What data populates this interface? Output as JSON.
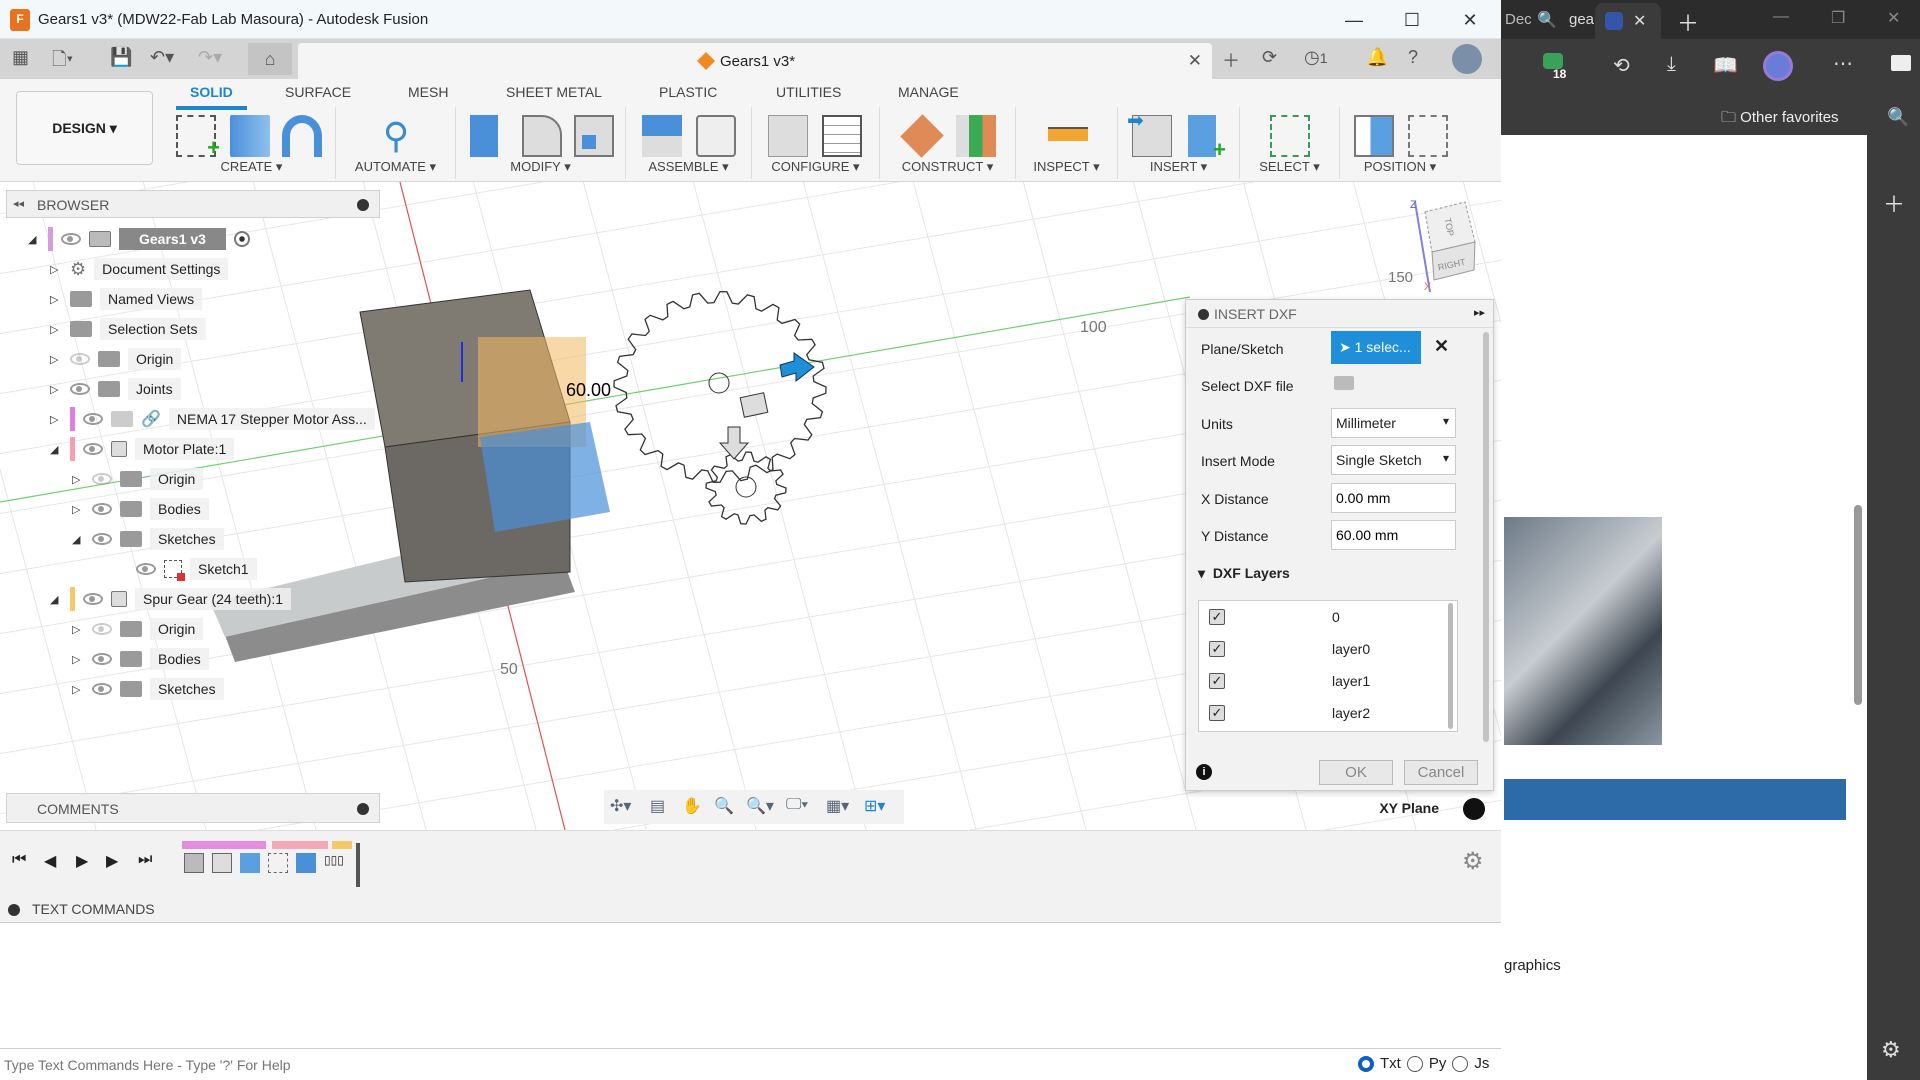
{
  "window": {
    "title": "Gears1 v3* (MDW22-Fab Lab Masoura) - Autodesk Fusion",
    "app_icon": "F",
    "doc_tab": "Gears1 v3*",
    "notifications_count": "1"
  },
  "ribbon": {
    "workspace": "DESIGN ▾",
    "tabs": [
      {
        "label": "SOLID",
        "active": true
      },
      {
        "label": "SURFACE"
      },
      {
        "label": "MESH"
      },
      {
        "label": "SHEET METAL"
      },
      {
        "label": "PLASTIC"
      },
      {
        "label": "UTILITIES"
      },
      {
        "label": "MANAGE"
      }
    ],
    "groups": [
      "CREATE ▾",
      "AUTOMATE ▾",
      "MODIFY ▾",
      "ASSEMBLE ▾",
      "CONFIGURE ▾",
      "CONSTRUCT ▾",
      "INSPECT ▾",
      "INSERT ▾",
      "SELECT ▾",
      "POSITION ▾"
    ]
  },
  "browser": {
    "title": "BROWSER",
    "items": [
      {
        "label": "Gears1 v3"
      },
      {
        "label": "Document Settings"
      },
      {
        "label": "Named Views"
      },
      {
        "label": "Selection Sets"
      },
      {
        "label": "Origin"
      },
      {
        "label": "Joints"
      },
      {
        "label": "NEMA 17 Stepper Motor Ass..."
      },
      {
        "label": "Motor Plate:1"
      },
      {
        "label": "Origin"
      },
      {
        "label": "Bodies"
      },
      {
        "label": "Sketches"
      },
      {
        "label": "Sketch1"
      },
      {
        "label": "Spur Gear (24 teeth):1"
      },
      {
        "label": "Origin"
      },
      {
        "label": "Bodies"
      },
      {
        "label": "Sketches"
      }
    ]
  },
  "viewport": {
    "dimension": "60.00",
    "grid_labels": [
      "100",
      "50",
      "150"
    ],
    "viewcube": {
      "top": "TOP",
      "right": "RIGHT",
      "z": "Z",
      "x": "X"
    },
    "plane": "XY Plane"
  },
  "comments": {
    "title": "COMMENTS"
  },
  "text_commands": {
    "title": "TEXT COMMANDS",
    "placeholder": "Type Text Commands Here - Type '?' For Help",
    "modes": [
      {
        "label": "Txt",
        "selected": true
      },
      {
        "label": "Py"
      },
      {
        "label": "Js"
      }
    ]
  },
  "dialog": {
    "title": "INSERT DXF",
    "plane_sketch_label": "Plane/Sketch",
    "plane_sketch_value": "1 selec...",
    "file_label": "Select DXF file",
    "units_label": "Units",
    "units_value": "Millimeter",
    "mode_label": "Insert Mode",
    "mode_value": "Single Sketch",
    "x_label": "X Distance",
    "x_value": "0.00 mm",
    "y_label": "Y Distance",
    "y_value": "60.00 mm",
    "layers_title": "DXF Layers",
    "layers": [
      {
        "name": "0",
        "checked": true
      },
      {
        "name": "layer0",
        "checked": true
      },
      {
        "name": "layer1",
        "checked": true
      },
      {
        "name": "layer2",
        "checked": true
      }
    ],
    "ok": "OK",
    "cancel": "Cancel"
  },
  "edge": {
    "tab1": "Dec",
    "tab2": "gea",
    "badge": "18",
    "favorites": "Other favorites",
    "page_text": "graphics"
  },
  "colors": {
    "accent": "#1e86c8",
    "selection": "#1e8fd8",
    "edge_dark": "#3b3b3b",
    "page_blue": "#2c6aa8"
  }
}
